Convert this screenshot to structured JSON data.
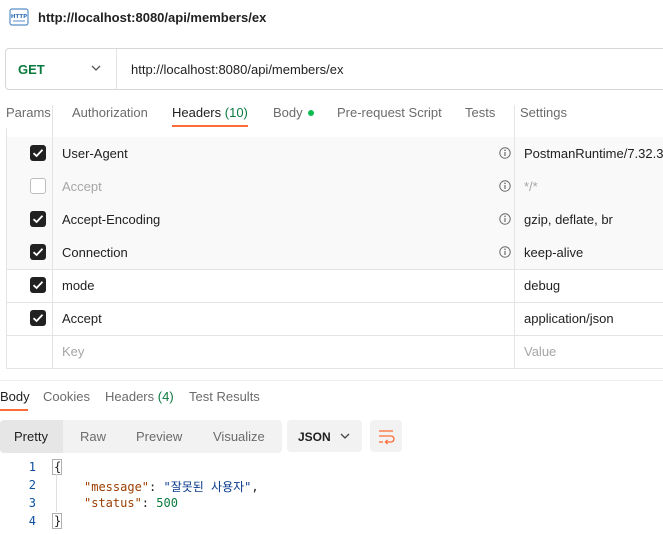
{
  "request": {
    "title": "http://localhost:8080/api/members/ex",
    "icon": "http-request-icon",
    "method": "GET",
    "url": "http://localhost:8080/api/members/ex"
  },
  "request_tabs": [
    {
      "label": "Params"
    },
    {
      "label": "Authorization"
    },
    {
      "label": "Headers",
      "count": "(10)",
      "active": true
    },
    {
      "label": "Body"
    },
    {
      "label": "Pre-request Script"
    },
    {
      "label": "Tests"
    },
    {
      "label": "Settings"
    }
  ],
  "headers": [
    {
      "key": "User-Agent",
      "value": "PostmanRuntime/7.32.3",
      "checked": true,
      "info": true
    },
    {
      "key": "Accept",
      "value": "*/*",
      "checked": false,
      "info": true
    },
    {
      "key": "Accept-Encoding",
      "value": "gzip, deflate, br",
      "checked": true,
      "info": true
    },
    {
      "key": "Connection",
      "value": "keep-alive",
      "checked": true,
      "info": true
    },
    {
      "key": "mode",
      "value": "debug",
      "checked": true,
      "info": false
    },
    {
      "key": "Accept",
      "value": "application/json",
      "checked": true,
      "info": false
    }
  ],
  "new_header": {
    "key_placeholder": "Key",
    "value_placeholder": "Value"
  },
  "response_tabs": [
    {
      "label": "Body",
      "active": true
    },
    {
      "label": "Cookies"
    },
    {
      "label": "Headers",
      "count": "(4)"
    },
    {
      "label": "Test Results"
    }
  ],
  "view_modes": [
    "Pretty",
    "Raw",
    "Preview",
    "Visualize"
  ],
  "active_view": "Pretty",
  "format": "JSON",
  "code": {
    "line_numbers": [
      "1",
      "2",
      "3",
      "4"
    ],
    "open_brace": "{",
    "close_brace": "}",
    "message_key": "\"message\"",
    "message_value": "\"잘못된 사용자\"",
    "status_key": "\"status\"",
    "status_value": "500"
  },
  "colors": {
    "accent": "#ff6c37",
    "method": "#0b7a3e"
  }
}
